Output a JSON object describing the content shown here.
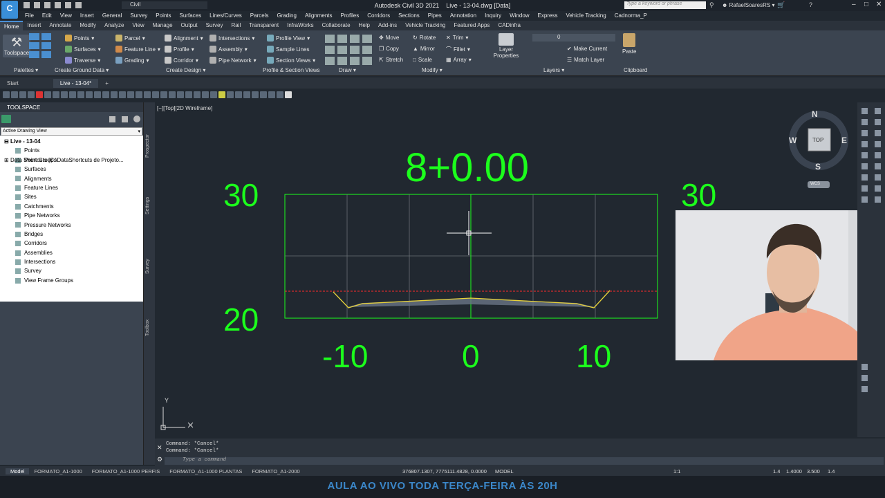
{
  "app": {
    "title_left": "Autodesk Civil 3D 2021",
    "title_right": "Live - 13-04.dwg [Data]",
    "workspace": "Civil",
    "search_placeholder": "Type a keyword or phrase",
    "user": "RafaelSoaresRS"
  },
  "menu": [
    "File",
    "Edit",
    "View",
    "Insert",
    "General",
    "Survey",
    "Points",
    "Surfaces",
    "Lines/Curves",
    "Parcels",
    "Grading",
    "Alignments",
    "Profiles",
    "Corridors",
    "Sections",
    "Pipes",
    "Annotation",
    "Inquiry",
    "Window",
    "Express",
    "Vehicle Tracking",
    "Cadnorma_P"
  ],
  "ribbon_tabs": [
    "Home",
    "Insert",
    "Annotate",
    "Modify",
    "Analyze",
    "View",
    "Manage",
    "Output",
    "Survey",
    "Rail",
    "Transparent",
    "InfraWorks",
    "Collaborate",
    "Help",
    "Add-ins",
    "Vehicle Tracking",
    "Featured Apps",
    "CADinfra"
  ],
  "ribbon": {
    "toolspace": "Toolspace",
    "points": "Points",
    "surfaces": "Surfaces",
    "traverse": "Traverse",
    "parcel": "Parcel",
    "feature_line": "Feature Line",
    "grading": "Grading",
    "alignment": "Alignment",
    "profile": "Profile",
    "corridor": "Corridor",
    "intersections": "Intersections",
    "assembly": "Assembly",
    "pipe_network": "Pipe Network",
    "profile_view": "Profile View",
    "sample_lines": "Sample Lines",
    "section_views": "Section Views",
    "move": "Move",
    "rotate": "Rotate",
    "trim": "Trim",
    "copy": "Copy",
    "mirror": "Mirror",
    "fillet": "Fillet",
    "stretch": "Stretch",
    "scale": "Scale",
    "array": "Array",
    "layer_properties": "Layer Properties",
    "layer_value": "0",
    "make_current": "Make Current",
    "match_layer": "Match Layer",
    "paste": "Paste",
    "panels": [
      "Palettes",
      "Create Ground Data",
      "Create Design",
      "Profile & Section Views",
      "Draw",
      "Modify",
      "Layers",
      "Clipboard"
    ]
  },
  "doc_tabs": [
    "Start",
    "Live - 13-04*"
  ],
  "toolspace": {
    "title": "TOOLSPACE",
    "view_select": "Active Drawing View",
    "root": "Live - 13-04",
    "items": [
      "Points",
      "Point Groups",
      "Surfaces",
      "Alignments",
      "Feature Lines",
      "Sites",
      "Catchments",
      "Pipe Networks",
      "Pressure Networks",
      "Bridges",
      "Corridors",
      "Assemblies",
      "Intersections",
      "Survey",
      "View Frame Groups"
    ],
    "shortcuts": "Data Shortcuts [C:\\DataShortcuts de Projeto...",
    "side_tabs": [
      "Prospector",
      "Settings",
      "Survey",
      "Toolbox"
    ]
  },
  "viewport": {
    "label": "[−][Top][2D Wireframe]",
    "station": "8+0.00",
    "elev_top_left": "30",
    "elev_top_right": "30",
    "elev_bottom_left": "20",
    "offset_left": "-10",
    "offset_center": "0",
    "offset_right": "10",
    "compass": {
      "n": "N",
      "s": "S",
      "e": "E",
      "w": "W",
      "top": "TOP",
      "wcs": "WCS"
    },
    "axis_y": "Y"
  },
  "command": {
    "history": [
      "Command: *Cancel*",
      "Command: *Cancel*"
    ],
    "placeholder": "Type a command"
  },
  "status": {
    "layouts": [
      "Model",
      "FORMATO_A1-1000",
      "FORMATO_A1-1000 PERFIS",
      "FORMATO_A1-1000 PLANTAS",
      "FORMATO_A1-2000"
    ],
    "coords": "376807.1307, 7775111.4828, 0.0000",
    "mode": "MODEL",
    "scale": "1:1",
    "values": [
      "1.4",
      "1.4000",
      "3.500",
      "1.4"
    ]
  },
  "banner": "AULA AO VIVO TODA TERÇA-FEIRA ÀS 20H",
  "colors": {
    "green": "#1cff1c",
    "accent": "#4a90d9",
    "banner": "#3b87c9"
  }
}
